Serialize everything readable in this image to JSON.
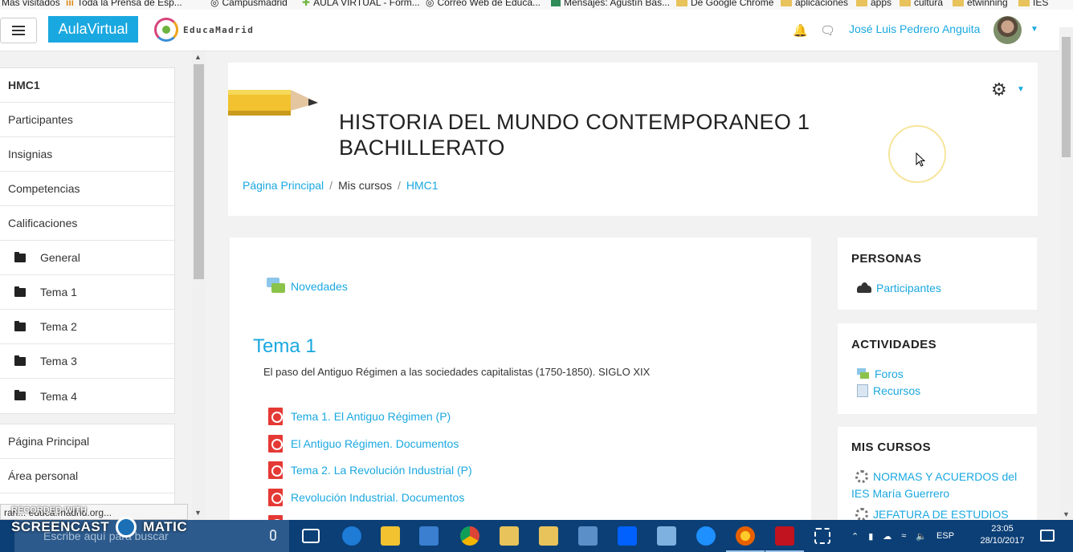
{
  "bookmarks": [
    {
      "label": "Más visitados"
    },
    {
      "label": "Toda la Prensa de Esp..."
    },
    {
      "label": "Campusmadrid"
    },
    {
      "label": "AULA VIRTUAL - Form..."
    },
    {
      "label": "Correo Web de Educa..."
    },
    {
      "label": "Mensajes: Agustín Bas..."
    },
    {
      "label": "De Google Chrome"
    },
    {
      "label": "aplicaciones"
    },
    {
      "label": "apps"
    },
    {
      "label": "cultura"
    },
    {
      "label": "etwinning"
    },
    {
      "label": "IES"
    }
  ],
  "navbar": {
    "brand": "AulaVirtual",
    "logo_text": "EducaMadrid",
    "user_name": "José Luis Pedrero Anguita"
  },
  "drawer": {
    "course_items": [
      {
        "label": "HMC1",
        "bold": true
      },
      {
        "label": "Participantes"
      },
      {
        "label": "Insignias"
      },
      {
        "label": "Competencias"
      },
      {
        "label": "Calificaciones"
      },
      {
        "label": "General",
        "folder": true
      },
      {
        "label": "Tema 1",
        "folder": true
      },
      {
        "label": "Tema 2",
        "folder": true
      },
      {
        "label": "Tema 3",
        "folder": true
      },
      {
        "label": "Tema 4",
        "folder": true
      }
    ],
    "site_items": [
      {
        "label": "Página Principal"
      },
      {
        "label": "Área personal"
      }
    ],
    "status_url": "ran... educa.madrid.org..."
  },
  "header": {
    "title": "HISTORIA DEL MUNDO CONTEMPORANEO 1 BACHILLERATO",
    "breadcrumb": [
      "Página Principal",
      "Mis cursos",
      "HMC1"
    ]
  },
  "content": {
    "news_label": "Novedades",
    "section_title": "Tema 1",
    "section_summary": "El paso del Antiguo Régimen a las sociedades capitalistas (1750-1850). SIGLO XIX",
    "resources": [
      "Tema 1. El Antiguo Régimen (P)",
      "El Antiguo Régimen. Documentos",
      "Tema 2. La Revolución Industrial (P)",
      "Revolución Industrial. Documentos"
    ]
  },
  "blocks": {
    "personas": {
      "title": "PERSONAS",
      "link": "Participantes"
    },
    "actividades": {
      "title": "ACTIVIDADES",
      "links": [
        "Foros",
        "Recursos"
      ]
    },
    "mis_cursos": {
      "title": "MIS CURSOS",
      "links": [
        "NORMAS Y ACUERDOS del IES María Guerrero",
        "JEFATURA DE ESTUDIOS"
      ]
    }
  },
  "watermark": {
    "recorded": "RECORDED WITH",
    "brand_left": "SCREENCAST",
    "brand_right": "MATIC"
  },
  "taskbar": {
    "search_placeholder": "Escribe aquí para buscar",
    "language": "ESP",
    "time": "23:05",
    "date": "28/10/2017"
  },
  "colors": {
    "accent": "#1aa8e0",
    "taskbar": "#0b3f76",
    "pdf": "#e53935"
  }
}
